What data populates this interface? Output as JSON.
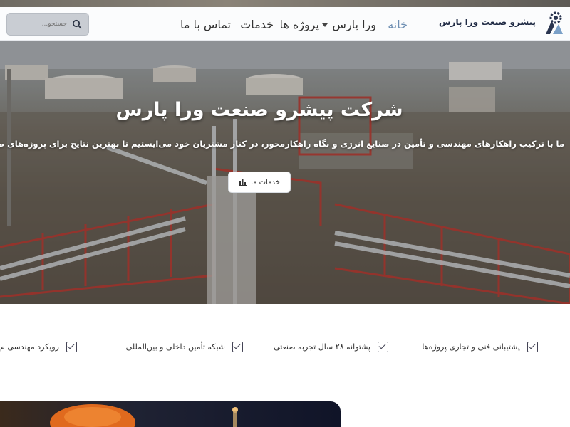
{
  "nav": {
    "brand": "پیشرو صنعت ورا پارس",
    "items": [
      "خانه",
      "ورا پارس",
      "پروژه ها",
      "خدمات",
      "تماس با ما"
    ],
    "search_placeholder": "جستجو..."
  },
  "hero": {
    "title": "شرکت پیشرو صنعت ورا پارس",
    "subtitle": "ما با ترکیب راهکارهای مهندسی و تأمین در صنایع انرژی و نگاه راهکارمحور، در کنار مشتریان خود می‌ایستیم تا بهترین نتایج برای پروژه‌های صنعتی رقم بخورد.",
    "button_label": "خدمات ما"
  },
  "features": [
    "پشتیبانی فنی و تجاری پروژه‌ها",
    "پشتوانه ۲۸ سال تجربه صنعتی",
    "شبکه تأمین داخلی و بین‌المللی",
    "رویکرد مهندسی م"
  ],
  "colors": {
    "accent": "#6e8fb3",
    "brand_dark": "#1f2a44",
    "hero_button_bg": "#ffffff"
  },
  "icons": {
    "logo": "gear-logo-icon",
    "search": "search-icon",
    "caret": "chevron-down-icon",
    "hero_button": "chart-icon",
    "feature": "checkbox-check-icon"
  }
}
